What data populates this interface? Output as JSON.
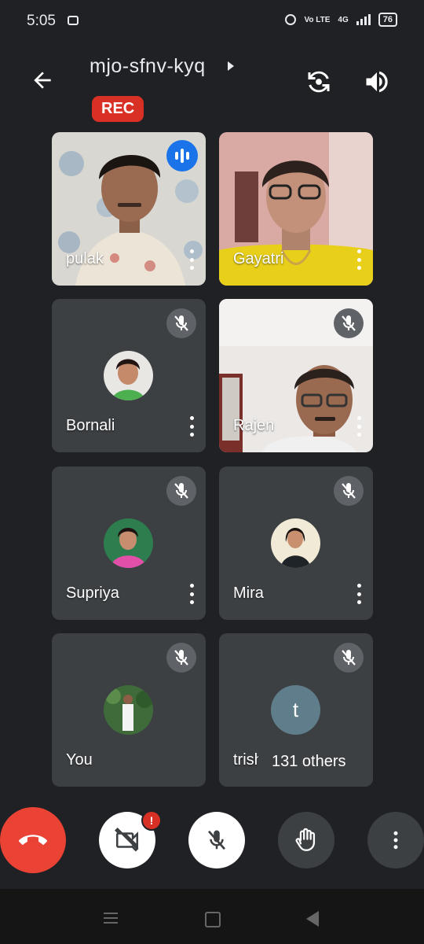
{
  "status": {
    "time": "5:05",
    "volte": "Vo LTE",
    "network": "4G",
    "battery": "76"
  },
  "meeting": {
    "code": "mjo-sfnv-kyq",
    "rec_label": "REC"
  },
  "participants": [
    {
      "name": "pulak"
    },
    {
      "name": "Gayatri"
    },
    {
      "name": "Bornali"
    },
    {
      "name": "Rajen"
    },
    {
      "name": "Supriya"
    },
    {
      "name": "Mira"
    },
    {
      "name": "You"
    },
    {
      "name": "trish",
      "initial": "t"
    }
  ],
  "others_label": "131 others",
  "colors": {
    "end_call": "#ea4335",
    "rec": "#d93025",
    "speaking": "#1a73e8",
    "tile": "#3c4043",
    "background": "#202124"
  },
  "icons": [
    "back-arrow-icon",
    "flip-camera-icon",
    "speaker-icon",
    "mic-off-icon",
    "camera-off-icon",
    "hand-raise-icon",
    "more-vert-icon",
    "end-call-icon"
  ]
}
